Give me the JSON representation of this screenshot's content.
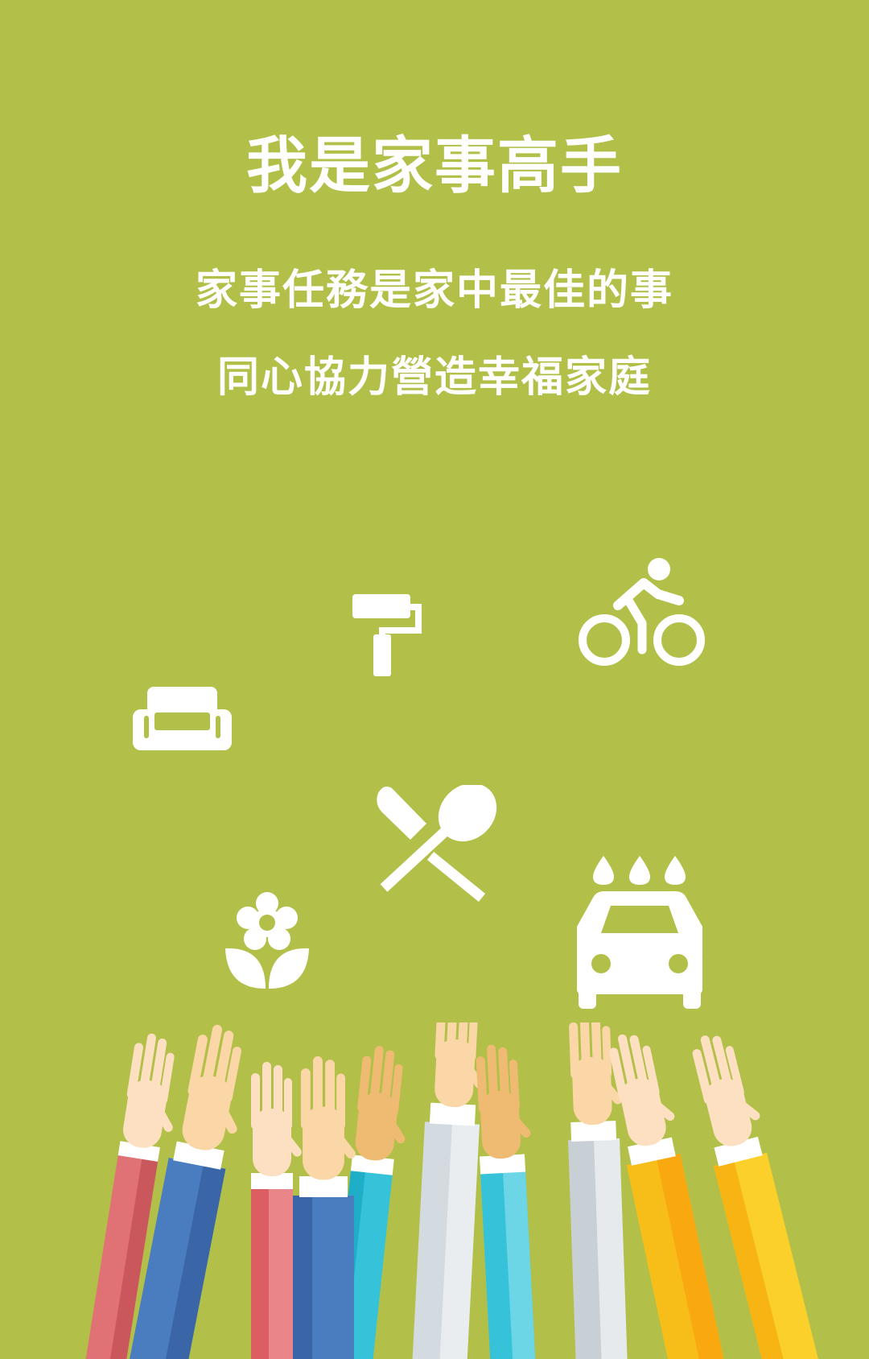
{
  "splash": {
    "title": "我是家事高手",
    "tagline_lines": [
      "家事任務是家中最佳的事",
      "同心協力營造幸福家庭"
    ]
  },
  "icons": [
    "sofa-icon",
    "paint-roller-icon",
    "bicycle-icon",
    "knife-spoon-icon",
    "flower-icon",
    "car-wash-icon"
  ],
  "illustration": "raised-hands",
  "colors": {
    "background": "#b2c049",
    "text": "#ffffff",
    "skin_light": "#fbd6a6",
    "skin_tan": "#efbb72",
    "sleeve_blue": "#4a7cc0",
    "sleeve_red": "#e07276",
    "sleeve_cyan": "#36c3d9",
    "sleeve_gray": "#d4dbe0",
    "sleeve_yellow": "#f7bd19"
  }
}
